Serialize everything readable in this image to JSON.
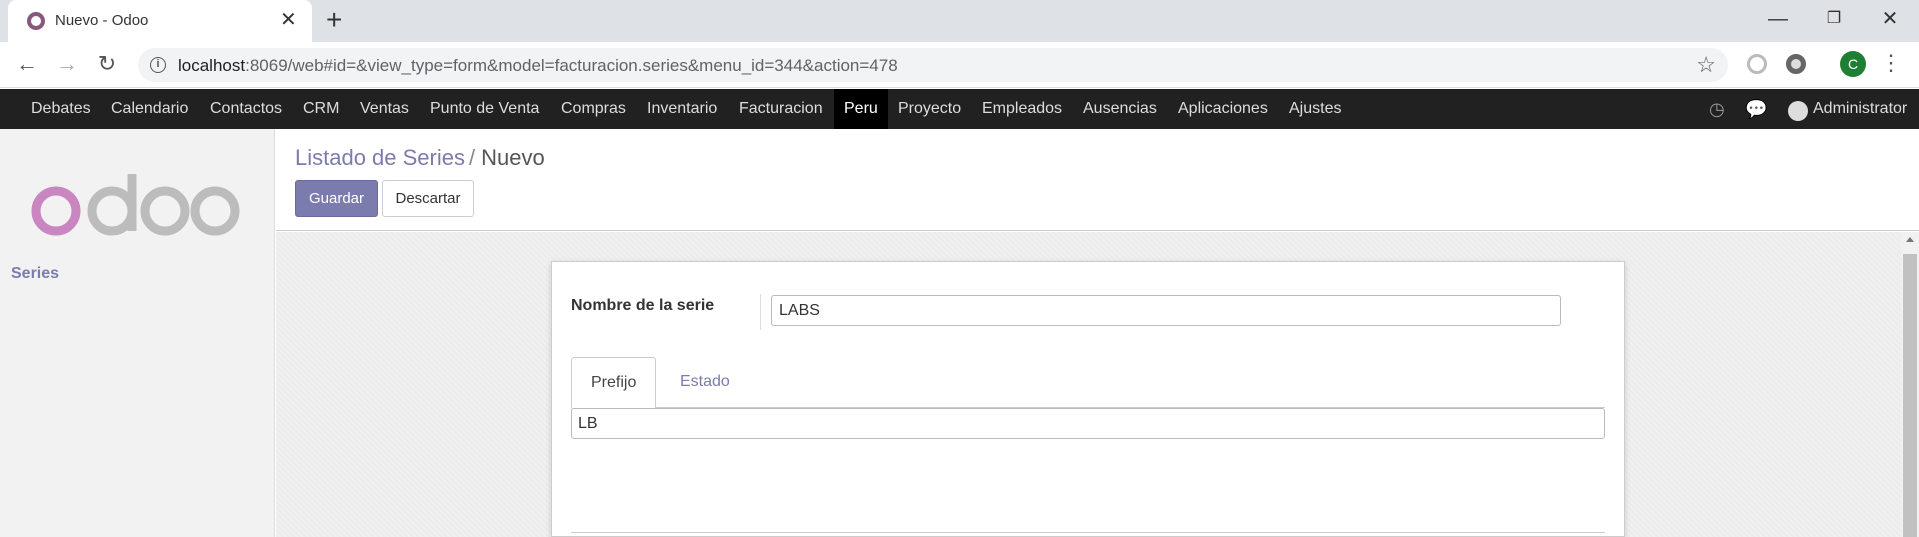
{
  "browser": {
    "tab_title": "Nuevo - Odoo",
    "url_host": "localhost",
    "url_rest": ":8069/web#id=&view_type=form&model=facturacion.series&menu_id=344&action=478",
    "profile_initial": "C"
  },
  "nav": {
    "menu_items": [
      "Debates",
      "Calendario",
      "Contactos",
      "CRM",
      "Ventas",
      "Punto de Venta",
      "Compras",
      "Inventario",
      "Facturacion",
      "Peru",
      "Proyecto",
      "Empleados",
      "Ausencias",
      "Aplicaciones",
      "Ajustes"
    ],
    "active_item": "Peru",
    "user_name": "Administrator"
  },
  "sidebar": {
    "logo_text": "odoo",
    "links": [
      "Series"
    ]
  },
  "control_panel": {
    "breadcrumb_parent": "Listado de Series",
    "breadcrumb_separator": "/",
    "breadcrumb_current": "Nuevo",
    "save_label": "Guardar",
    "discard_label": "Descartar"
  },
  "form": {
    "name_label": "Nombre de la serie",
    "name_value": "LABS",
    "tabs": [
      "Prefijo",
      "Estado"
    ],
    "active_tab": "Prefijo",
    "prefix_value": "LB"
  },
  "colors": {
    "brand": "#7c7bad",
    "nav_bg": "#212121",
    "active_nav_bg": "#000000",
    "logo_pink": "#c986c1",
    "logo_gray": "#bcbcbc"
  },
  "icons": {
    "back": "arrow-left-icon",
    "forward": "arrow-right-icon",
    "reload": "reload-icon",
    "info": "info-icon",
    "bookmark": "star-icon",
    "activity": "clock-icon",
    "messaging": "chat-icon"
  }
}
